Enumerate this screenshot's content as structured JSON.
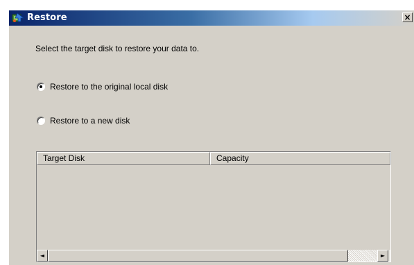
{
  "window": {
    "title": "Restore",
    "close_label": "×"
  },
  "instruction": "Select the target disk to restore your data to.",
  "options": [
    {
      "label": "Restore to the original local disk",
      "selected": true
    },
    {
      "label": "Restore to a new disk",
      "selected": false
    }
  ],
  "table": {
    "columns": [
      "Target Disk",
      "Capacity"
    ],
    "rows": []
  },
  "scrollbar": {
    "left_arrow": "◄",
    "right_arrow": "►"
  }
}
